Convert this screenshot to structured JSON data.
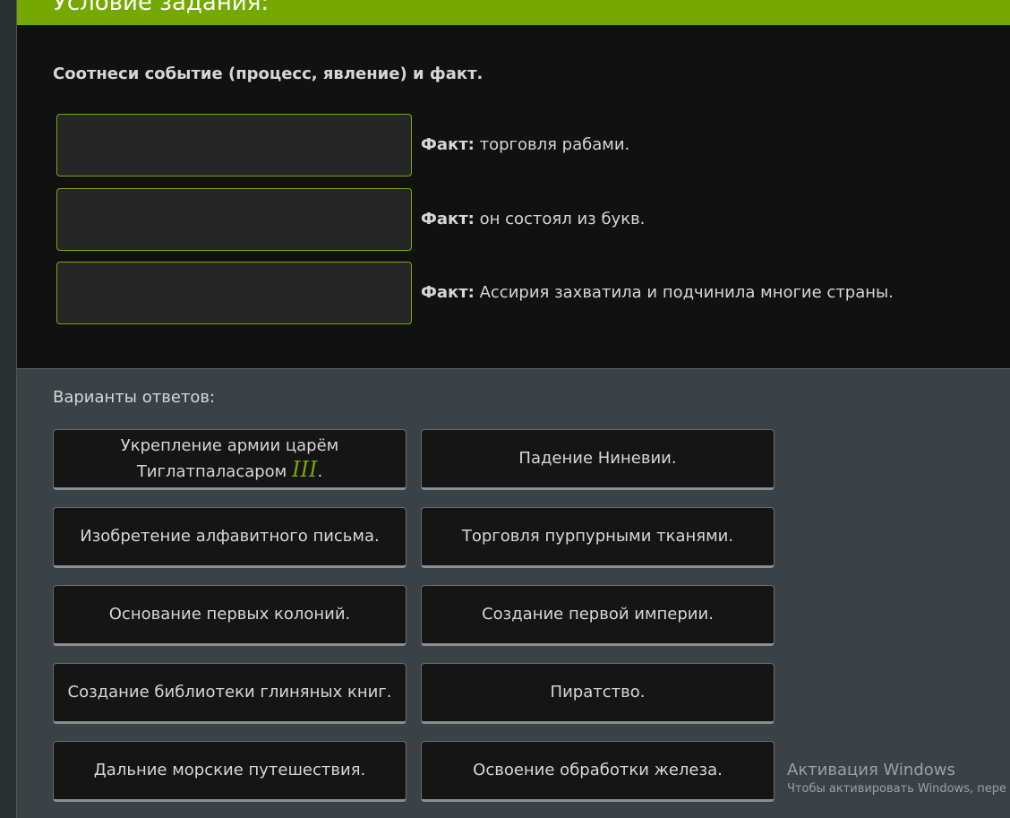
{
  "header": {
    "title": "Условие задания:"
  },
  "task": {
    "instruction": "Соотнеси событие (процесс, явление) и факт.",
    "fact_label": "Факт:",
    "facts": [
      "торговля рабами.",
      "он состоял из букв.",
      "Ассирия захватила и подчинила многие страны."
    ]
  },
  "answers": {
    "title": "Варианты ответов:",
    "options": [
      {
        "text": "Укрепление армии царём Тиглатпаласаром",
        "math": "III",
        "suffix": "."
      },
      {
        "text": "Падение Ниневии."
      },
      {
        "text": "Изобретение алфавитного письма."
      },
      {
        "text": "Торговля пурпурными тканями."
      },
      {
        "text": "Основание первых колоний."
      },
      {
        "text": "Создание первой империи."
      },
      {
        "text": "Создание библиотеки глиняных книг."
      },
      {
        "text": "Пиратство."
      },
      {
        "text": "Дальние морские путешествия."
      },
      {
        "text": "Освоение обработки железа."
      }
    ]
  },
  "watermark": {
    "title": "Активация Windows",
    "subtitle": "Чтобы активировать Windows, пере"
  },
  "colors": {
    "accent": "#76a900",
    "task_bg": "#111111",
    "answers_bg": "#3b4245"
  }
}
